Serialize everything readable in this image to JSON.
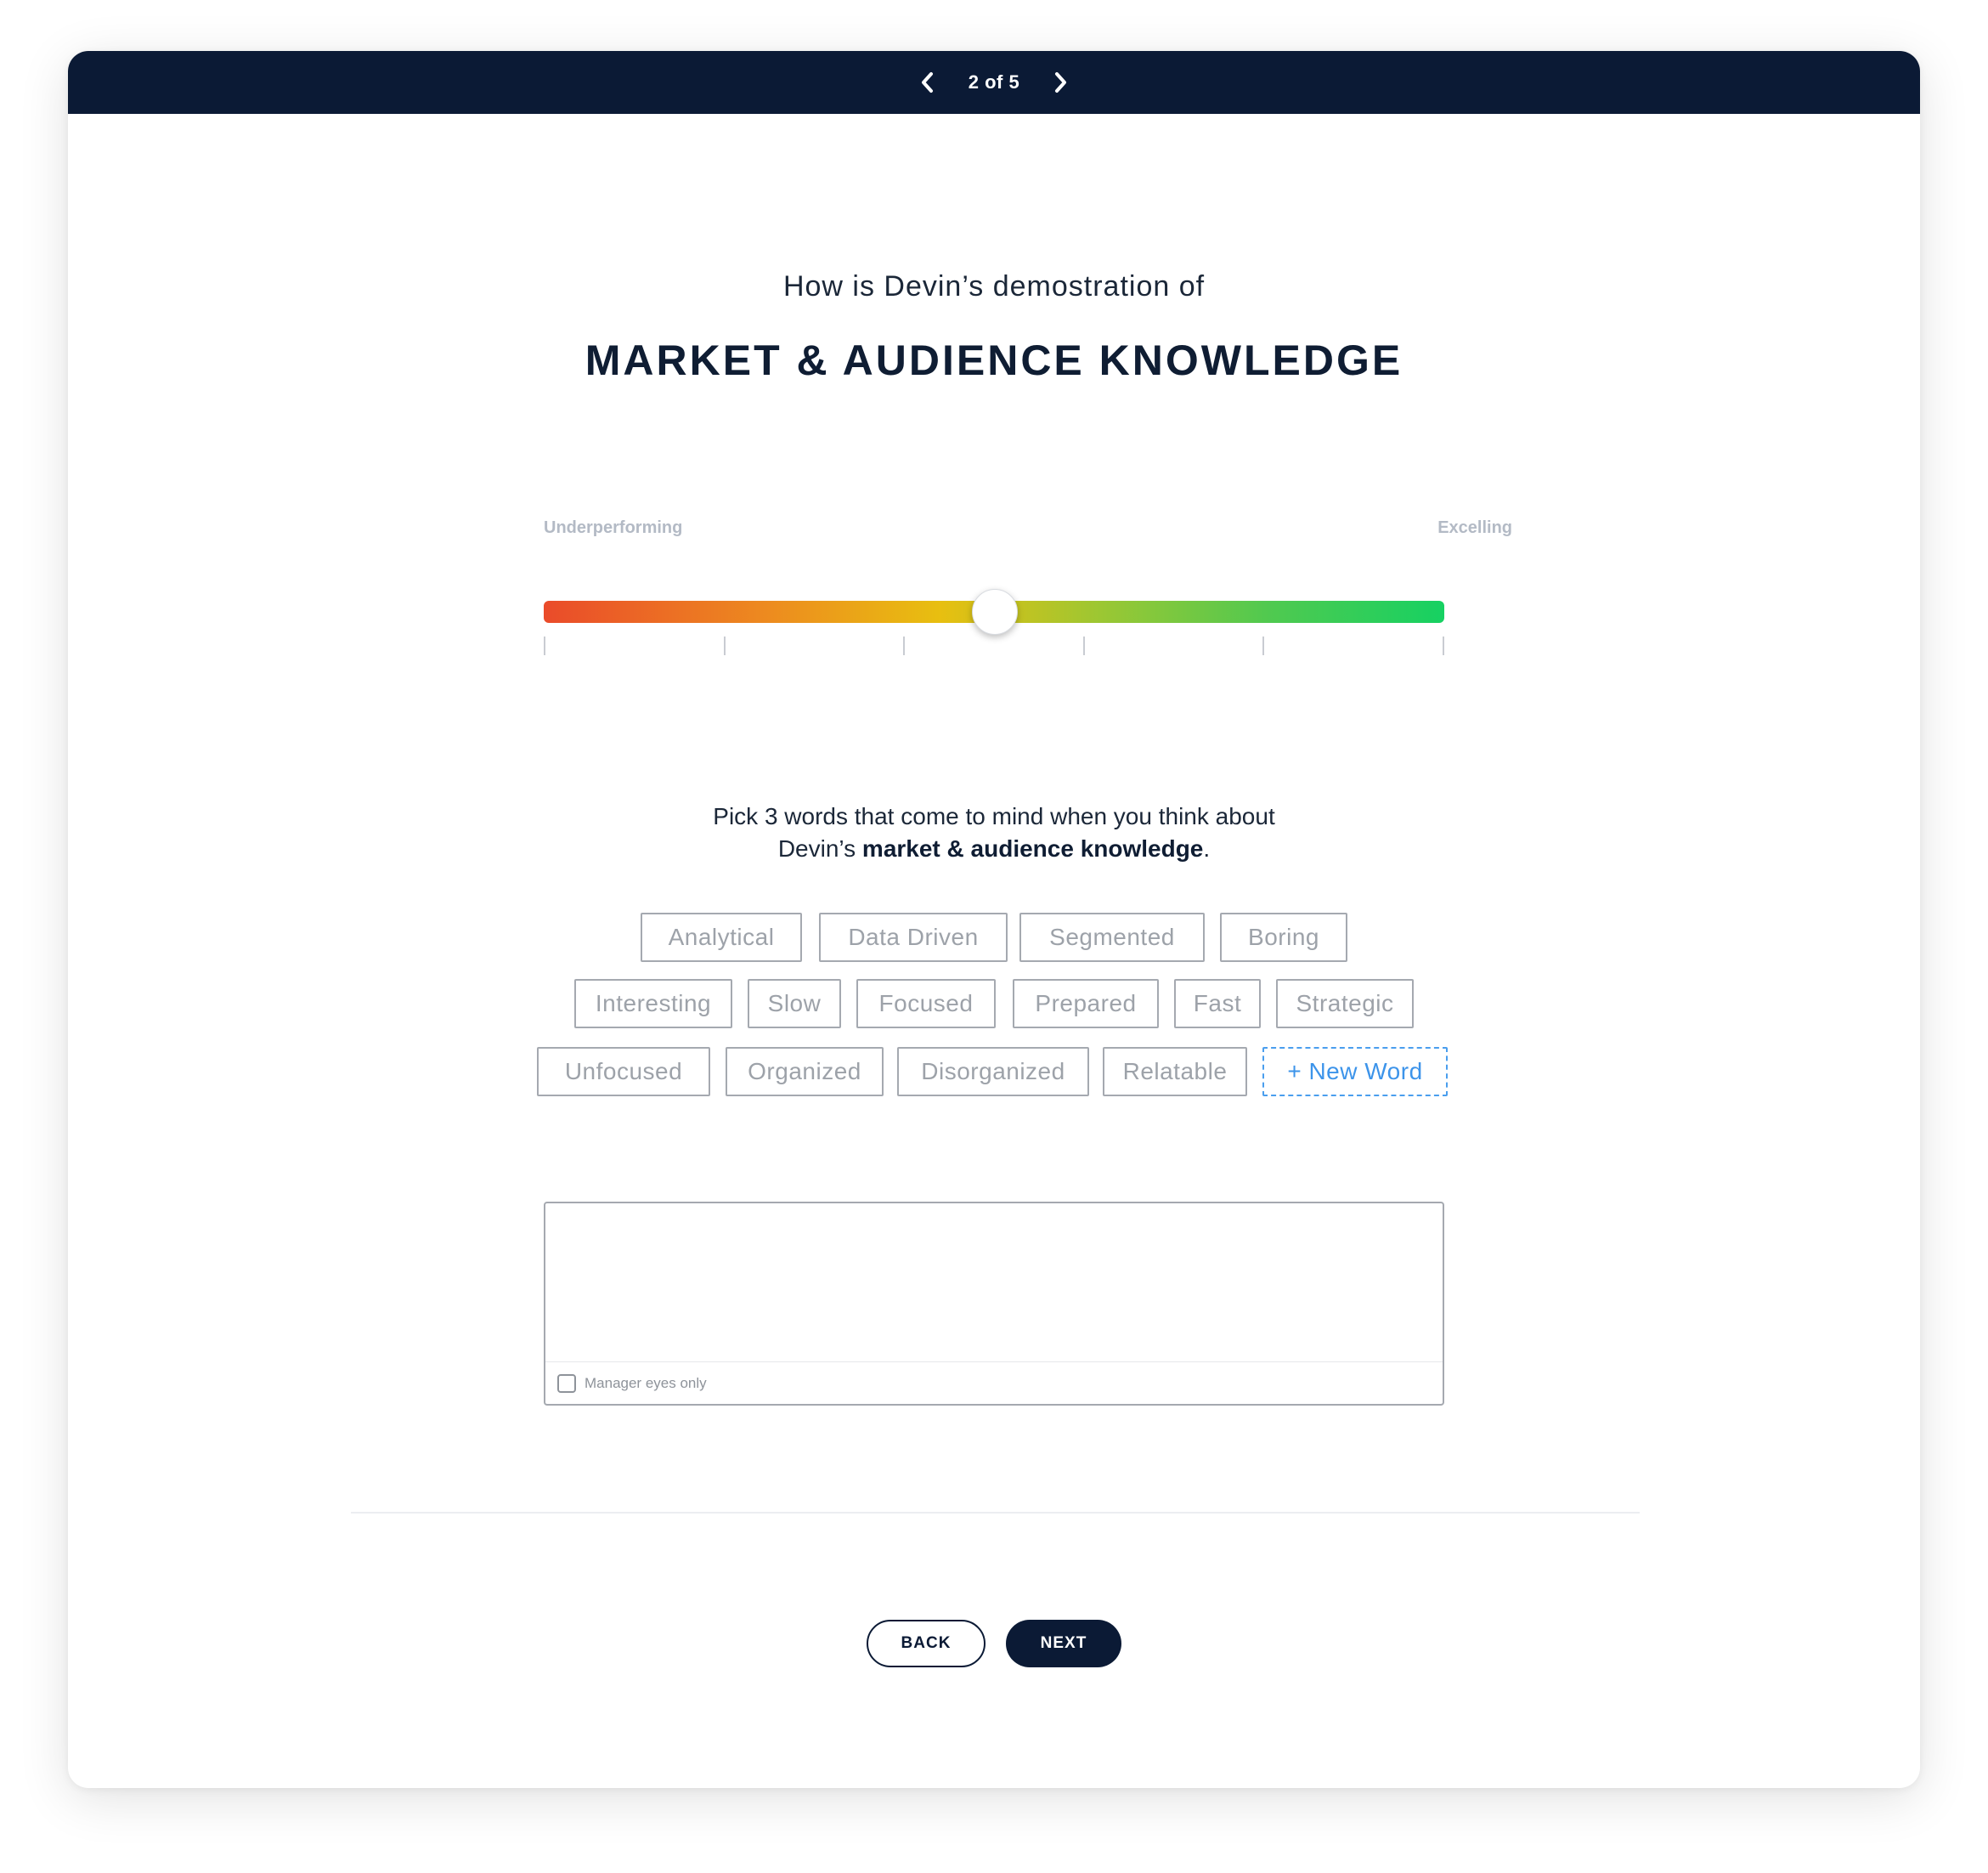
{
  "topbar": {
    "pager": "2 of 5",
    "prev_icon": "chevron-left-icon",
    "next_icon": "chevron-right-icon"
  },
  "question": {
    "intro": "How is Devin’s demostration of",
    "heading": "MARKET & AUDIENCE KNOWLEDGE"
  },
  "scale": {
    "left_label": "Underperforming",
    "right_label": "Excelling",
    "value": 0.5,
    "tick_count": 6,
    "gradient_colors": [
      "#ea4b2a",
      "#ed8b1f",
      "#e8bf10",
      "#9bc733",
      "#52c94f",
      "#16d162"
    ]
  },
  "prompt": {
    "line1": "Pick 3 words that come to mind when you think about",
    "line2_prefix": "Devin’s ",
    "line2_bold": "market & audience knowledge",
    "line2_suffix": "."
  },
  "words": {
    "row1": [
      "Analytical",
      "Data Driven",
      "Segmented",
      "Boring"
    ],
    "row2": [
      "Interesting",
      "Slow",
      "Focused",
      "Prepared",
      "Fast",
      "Strategic"
    ],
    "row3": [
      "Unfocused",
      "Organized",
      "Disorganized",
      "Relatable"
    ],
    "new_word": "+ New Word"
  },
  "comment": {
    "value": "",
    "checkbox_label": "Manager eyes only",
    "checked": false
  },
  "buttons": {
    "back": "BACK",
    "next": "NEXT"
  },
  "colors": {
    "navy": "#0b1a35",
    "accent_blue": "#3d94ea",
    "chip_text": "#9da2a9"
  }
}
